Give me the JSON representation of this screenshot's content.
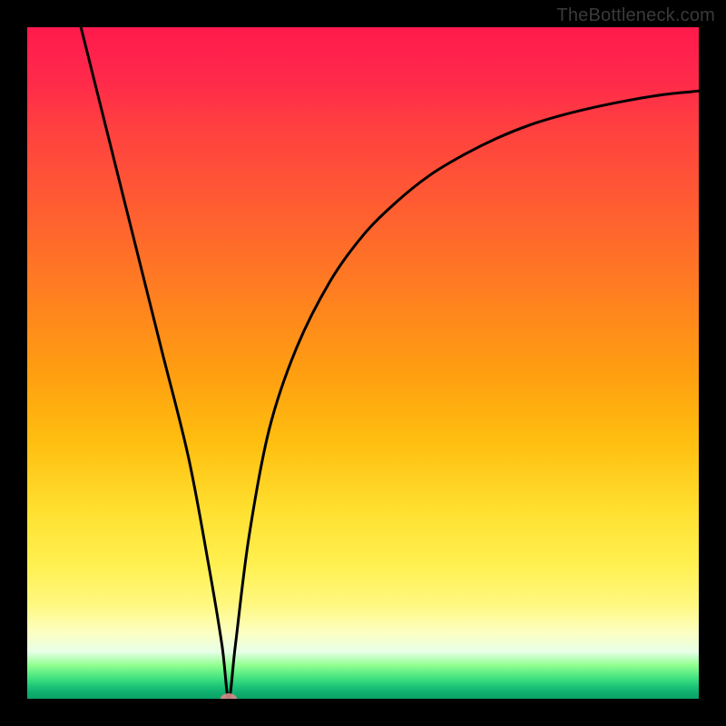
{
  "attribution": "TheBottleneck.com",
  "chart_data": {
    "type": "line",
    "title": "",
    "xlabel": "",
    "ylabel": "",
    "xlim": [
      0,
      100
    ],
    "ylim": [
      0,
      100
    ],
    "grid": false,
    "legend": false,
    "annotations": [],
    "series": [
      {
        "name": "curve",
        "x": [
          8,
          12,
          16,
          20,
          24,
          27,
          29,
          30,
          31,
          33,
          36,
          40,
          45,
          50,
          55,
          60,
          65,
          70,
          75,
          80,
          85,
          90,
          95,
          100
        ],
        "y": [
          100,
          84,
          68,
          52,
          36,
          20,
          8,
          0,
          8,
          24,
          40,
          52,
          62,
          69,
          74,
          78,
          81,
          83.5,
          85.5,
          87,
          88.2,
          89.2,
          90,
          90.5
        ]
      }
    ],
    "marker": {
      "x": 30,
      "y": 0
    },
    "gradient_stops": [
      {
        "pos": 0,
        "color": "#ff1a4d"
      },
      {
        "pos": 40,
        "color": "#ff8020"
      },
      {
        "pos": 72,
        "color": "#ffe030"
      },
      {
        "pos": 90,
        "color": "#fcffc0"
      },
      {
        "pos": 100,
        "color": "#0aa066"
      }
    ]
  }
}
